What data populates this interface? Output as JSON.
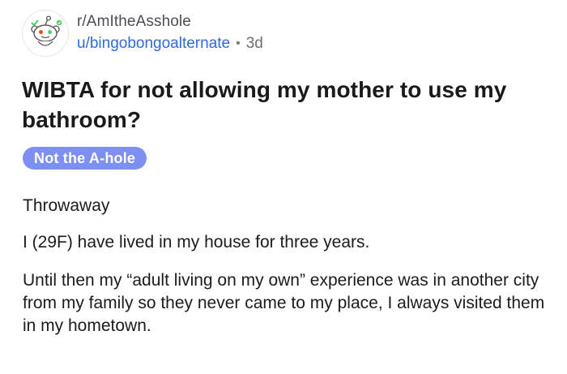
{
  "header": {
    "subreddit": "r/AmItheAsshole",
    "username": "u/bingobongoalternate",
    "separator": "•",
    "age": "3d"
  },
  "post": {
    "title": "WIBTA for not allowing my mother to use my bathroom?",
    "flair": "Not the A-hole",
    "paragraphs": [
      "Throwaway",
      "I (29F) have lived in my house for three years.",
      "Until then my “adult living on my own” experience was in another city from my family so they never came to my place, I always visited them in my hometown."
    ]
  },
  "colors": {
    "flair_bg": "#7d8ff1",
    "username": "#2e6bd8",
    "snoo_green": "#46d160",
    "snoo_orange": "#ff4500"
  }
}
